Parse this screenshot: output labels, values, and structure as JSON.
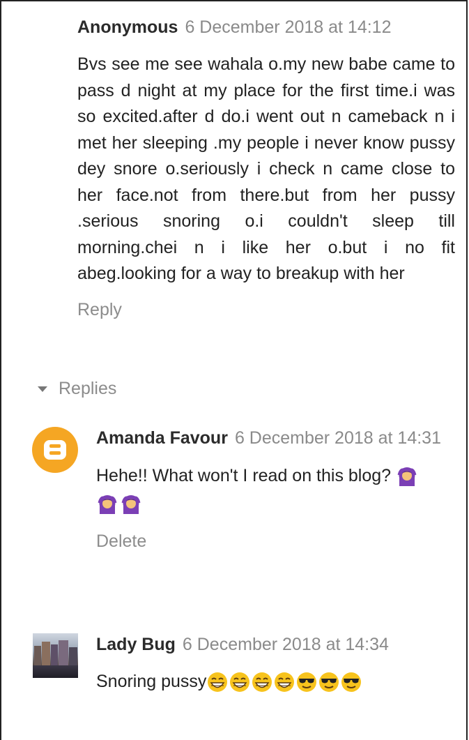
{
  "comments": {
    "main": {
      "author": "Anonymous",
      "date": "6 December 2018 at 14:12",
      "body": "Bvs see me see wahala o.my new babe came to pass d night at my place for the first time.i was so excited.after d do.i went out n cameback n i met her sleeping .my people i never know pussy dey snore o.seriously i check n came close to her face.not from there.but from her pussy .serious snoring o.i couldn't sleep till morning.chei n i like her o.but i no fit abeg.looking for a way to breakup with her",
      "reply_label": "Reply"
    },
    "replies_label": "Replies",
    "replies": [
      {
        "author": "Amanda Favour",
        "date": "6 December 2018 at 14:31",
        "body": "Hehe!! What won't I read on this blog?",
        "action_label": "Delete",
        "avatar": "blogger-logo-icon"
      },
      {
        "author": "Lady Bug",
        "date": "6 December 2018 at 14:34",
        "body": "Snoring pussy",
        "avatar": "city-photo-avatar"
      }
    ]
  },
  "icons": {
    "replies_toggle": "caret-down-icon",
    "emoji_1": "woman-gesturing-ok-emoji",
    "emoji_2": "grinning-emoji",
    "emoji_3": "cool-sunglasses-emoji"
  },
  "colors": {
    "accent_orange": "#f5a623",
    "author_text": "#2b2b2b",
    "meta_text": "#8a8a8a",
    "emoji_purple": "#7b3fb5",
    "emoji_yellow": "#f7c31d"
  }
}
